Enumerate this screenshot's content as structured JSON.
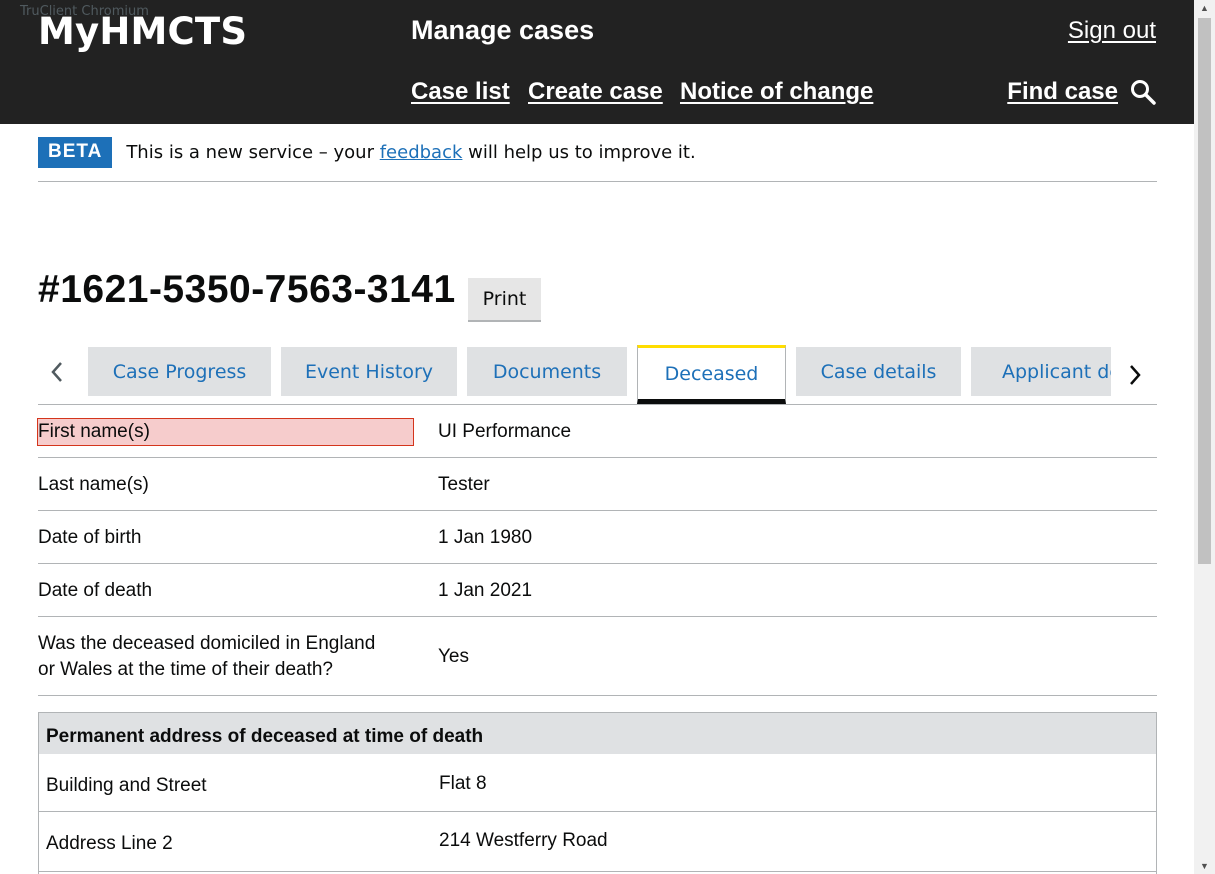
{
  "browser_label": "TruClient Chromium",
  "header": {
    "brand": "MyHMCTS",
    "service": "Manage cases",
    "sign_out": "Sign out",
    "nav": [
      "Case list",
      "Create case",
      "Notice of change"
    ],
    "find_case": "Find case"
  },
  "beta": {
    "tag": "BETA",
    "text_before": "This is a new service – your ",
    "link": "feedback",
    "text_after": " will help us to improve it."
  },
  "case": {
    "title": "#1621-5350-7563-3141",
    "print_label": "Print"
  },
  "tabs": [
    "Case Progress",
    "Event History",
    "Documents",
    "Deceased",
    "Case details",
    "Applicant details"
  ],
  "active_tab": "Deceased",
  "deceased": {
    "first_name_label": "First name(s)",
    "first_name": "UI Performance",
    "last_name_label": "Last name(s)",
    "last_name": "Tester",
    "dob_label": "Date of birth",
    "dob": "1 Jan 1980",
    "dod_label": "Date of death",
    "dod": "1 Jan 2021",
    "domicile_label_1": "Was the deceased domiciled in England",
    "domicile_label_2": "or Wales at the time of their death?",
    "domicile": "Yes"
  },
  "address": {
    "heading": "Permanent address of deceased at time of death",
    "building_label": "Building and Street",
    "building": "Flat 8",
    "line2_label": "Address Line 2",
    "line2": "214 Westferry Road"
  },
  "colors": {
    "header_bg": "#222222",
    "link": "#1d70b8",
    "active_tab_top": "#ffdd00",
    "highlight": "#f6cccc"
  }
}
